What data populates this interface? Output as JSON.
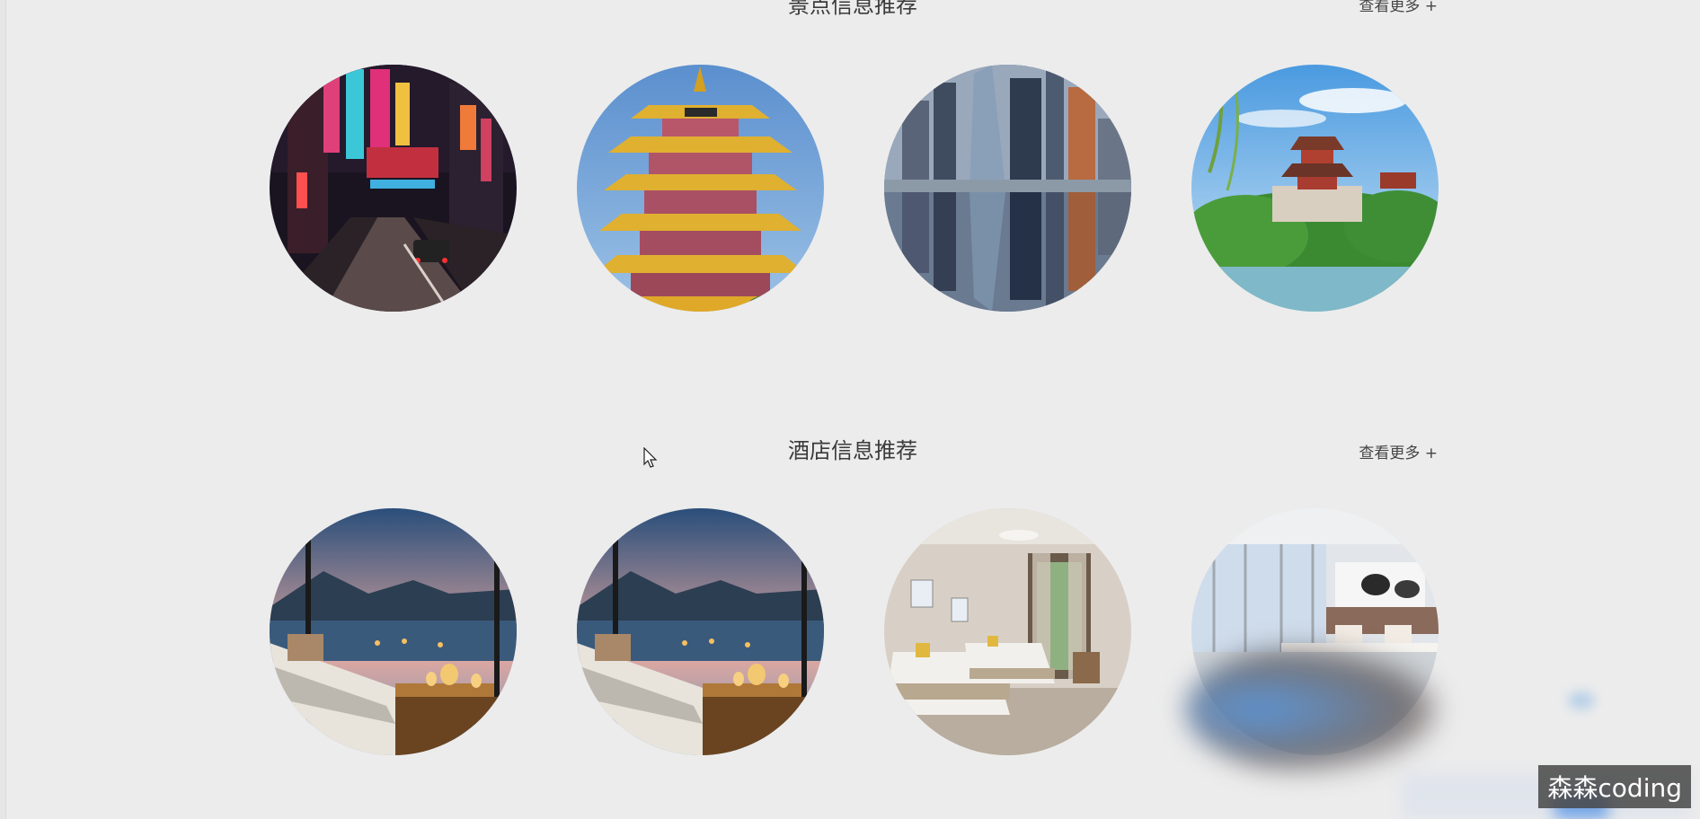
{
  "attractions": {
    "title": "景点信息推荐",
    "more_label": "查看更多 +",
    "items": [
      {
        "icon": "city-night-street-image"
      },
      {
        "icon": "yellow-crane-tower-image"
      },
      {
        "icon": "skyscraper-reflection-image"
      },
      {
        "icon": "summer-palace-pagoda-image"
      }
    ]
  },
  "hotels": {
    "title": "酒店信息推荐",
    "more_label": "查看更多 +",
    "items": [
      {
        "icon": "seaview-room-image"
      },
      {
        "icon": "seaview-room-image"
      },
      {
        "icon": "twin-bed-room-image"
      },
      {
        "icon": "bright-hotel-room-image"
      }
    ]
  },
  "watermark": "森森coding",
  "colors": {
    "background": "#ececec",
    "text": "#3a3a3a"
  }
}
